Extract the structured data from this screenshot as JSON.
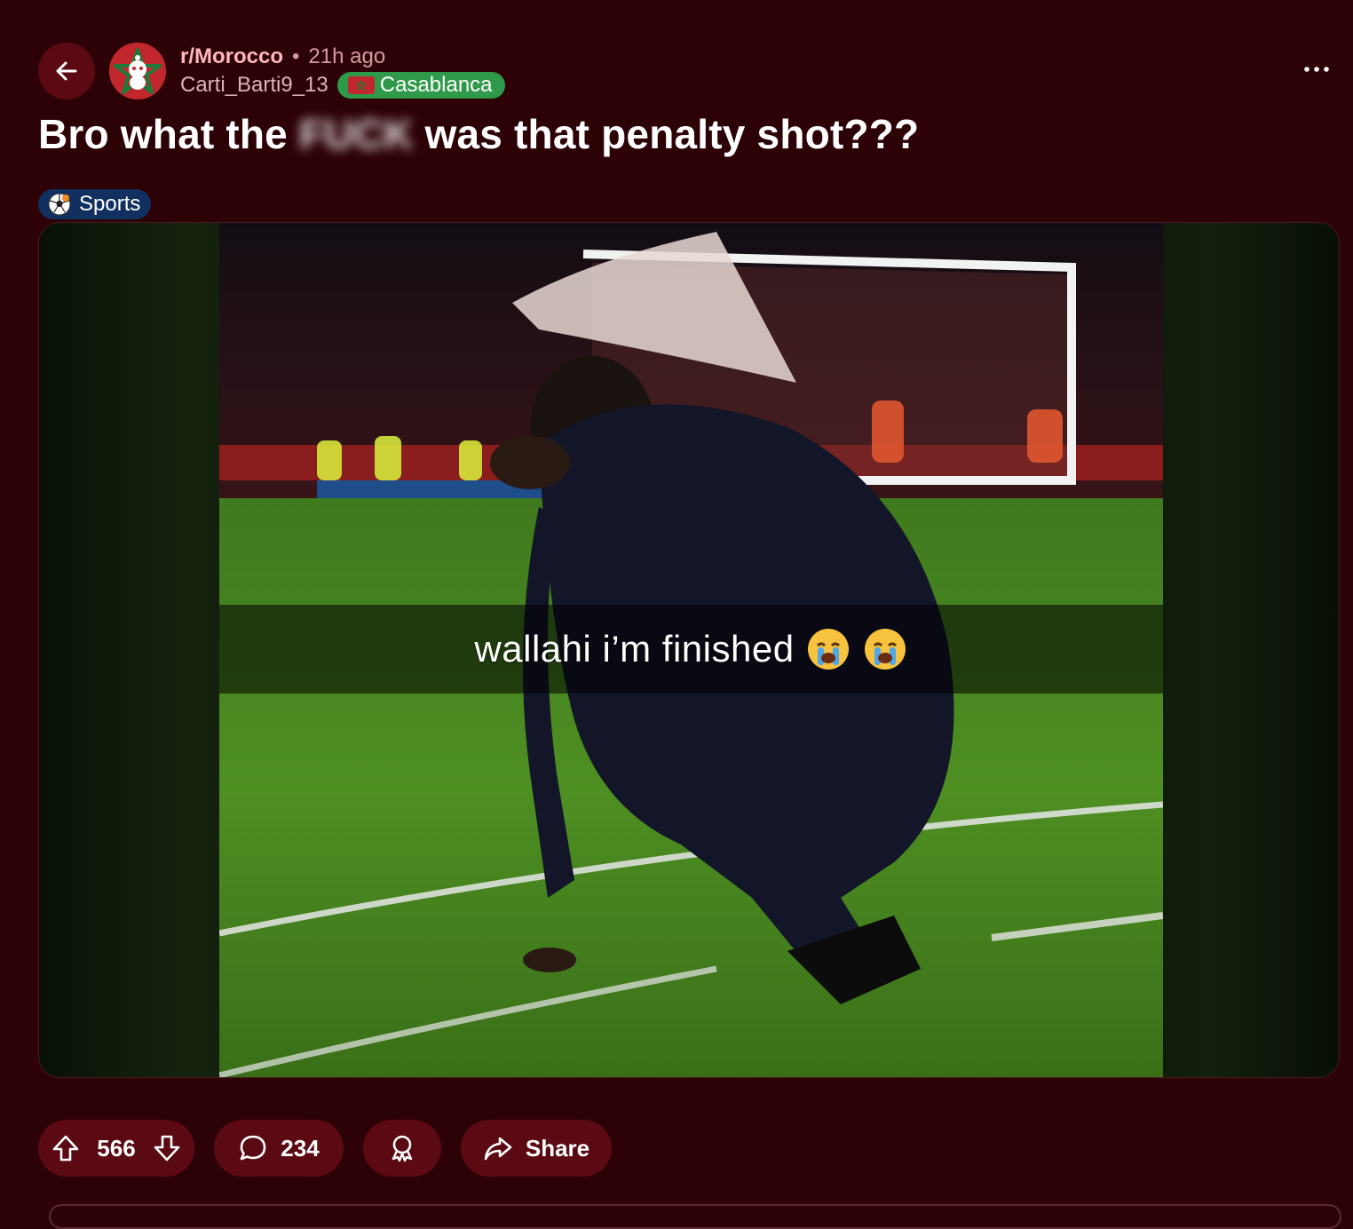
{
  "post": {
    "subreddit": "r/Morocco",
    "separator": "•",
    "time_ago": "21h ago",
    "author": "Carti_Barti9_13",
    "user_flair": "Casablanca",
    "title_start": "Bro what the",
    "title_censored": "FUCK",
    "title_end": "was that penalty shot???",
    "post_flair": "Sports"
  },
  "media": {
    "caption": "wallahi i’m finished"
  },
  "actions": {
    "vote_count": "566",
    "comment_count": "234",
    "share_label": "Share"
  },
  "icons": {
    "back": "arrow-left-icon",
    "more": "ellipsis-icon",
    "upvote": "arrow-up-icon",
    "downvote": "arrow-down-icon",
    "comment": "speech-bubble-icon",
    "award": "award-icon",
    "share": "share-arrow-icon"
  },
  "colors": {
    "background": "#2d0207",
    "pill": "#5b0912",
    "flair_green": "#2f9a49",
    "flair_blue": "#11305f",
    "subreddit_text": "#ffb7bd"
  }
}
